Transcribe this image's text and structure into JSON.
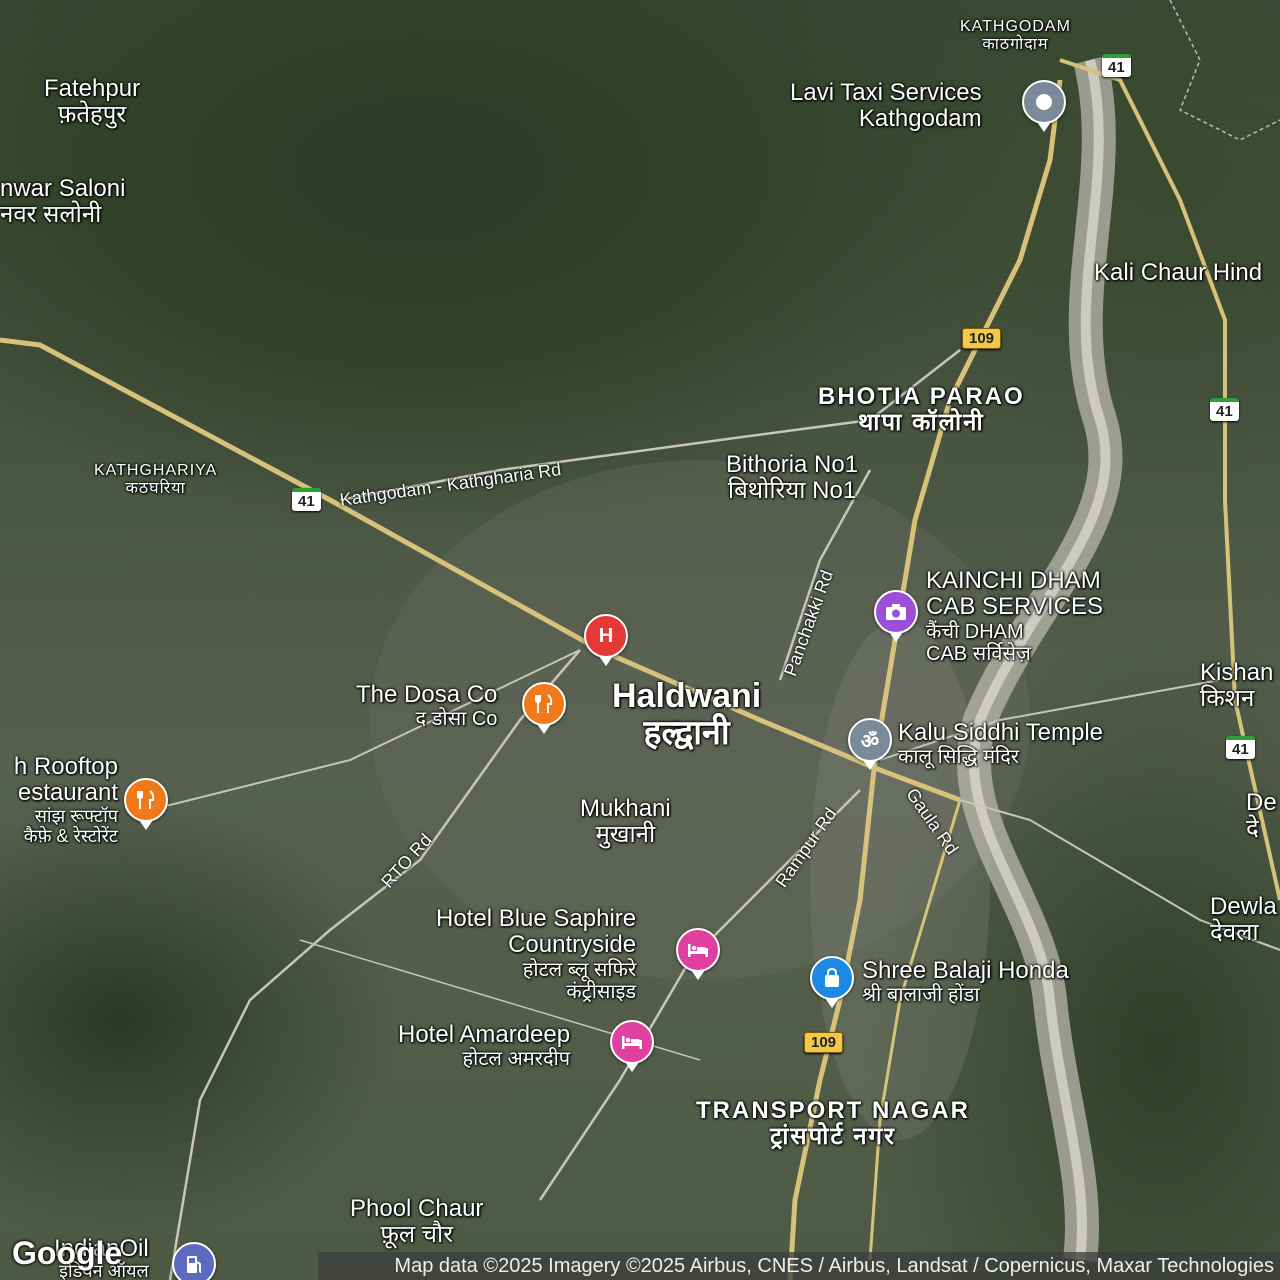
{
  "map": {
    "areas": {
      "kathgodam": {
        "en": "KATHGODAM",
        "hi": "काठगोदाम"
      },
      "bhotia_parao": {
        "en": "BHOTIA PARAO",
        "hi": "थापा कॉलोनी"
      },
      "kathghariya": {
        "en": "KATHGHARIYA",
        "hi": "कठघरिया"
      },
      "transport_nagar": {
        "en": "TRANSPORT NAGAR",
        "hi": "ट्रांसपोर्ट नगर"
      }
    },
    "places": {
      "fatehpur": {
        "en": "Fatehpur",
        "hi": "फ़तेहपुर"
      },
      "kanwar_saloni": {
        "en": "nwar Saloni",
        "hi": "नवर सलोनी"
      },
      "bithoria": {
        "en": "Bithoria No1",
        "hi": "बिथोरिया No1"
      },
      "haldwani": {
        "en": "Haldwani",
        "hi": "हल्द्वानी"
      },
      "mukhani": {
        "en": "Mukhani",
        "hi": "मुखानी"
      },
      "phool_chaur": {
        "en": "Phool Chaur",
        "hi": "फ़ूल चौर"
      },
      "kali_chaur": {
        "en": "Kali Chaur Hind"
      },
      "kishan": {
        "en": "Kishan",
        "hi": "किशन"
      },
      "de": {
        "en": "De",
        "hi": "दे"
      },
      "dewla": {
        "en": "Dewla",
        "hi": "देवला"
      }
    },
    "pois": {
      "lavi_taxi": {
        "name": "Lavi Taxi Services Kathgodam",
        "line1": "Lavi Taxi Services",
        "line2": "Kathgodam",
        "icon": "location-pin-icon",
        "color": "#7b8a99"
      },
      "kainchi_dham": {
        "line1": "KAINCHI DHAM",
        "line2": "CAB SERVICES",
        "hi1": "कैंची DHAM",
        "hi2": "CAB सर्विसेज़",
        "icon": "camera-icon",
        "color": "#9a4fd6"
      },
      "hospital": {
        "icon": "hospital-icon",
        "glyph": "H",
        "color": "#e53935"
      },
      "dosa_co": {
        "name": "The Dosa Co",
        "hi": "द डोसा Co",
        "icon": "restaurant-icon",
        "color": "#f07a1a"
      },
      "rooftop": {
        "line1": "h Rooftop",
        "line2": "estaurant",
        "hi1": "सांझ रूफ्टॉप",
        "hi2": "कैफ़े & रेस्टोरेंट",
        "icon": "restaurant-icon",
        "color": "#f07a1a"
      },
      "kalu_siddhi": {
        "name": "Kalu Siddhi Temple",
        "hi": "कालू सिद्धि मंदिर",
        "icon": "om-icon",
        "glyph": "ॐ",
        "color": "#7b8a99"
      },
      "blue_saphire": {
        "line1": "Hotel Blue Saphire",
        "line2": "Countryside",
        "hi1": "होटल ब्लू सफिरे",
        "hi2": "कंट्रीसाइड",
        "icon": "hotel-icon",
        "color": "#e040a0"
      },
      "amardeep": {
        "name": "Hotel Amardeep",
        "hi": "होटल अमरदीप",
        "icon": "hotel-icon",
        "color": "#e040a0"
      },
      "balaji_honda": {
        "name": "Shree Balaji Honda",
        "hi": "श्री बालाजी होंडा",
        "icon": "shopping-bag-icon",
        "color": "#1e88e5"
      },
      "indianoil": {
        "name": "IndianOil",
        "hi": "इंडियन ऑयल",
        "icon": "fuel-icon",
        "color": "#5c6bc0"
      }
    },
    "roads": {
      "kathgodam_kathgharia": "Kathgodam - Kathgharia Rd",
      "panchakki": "Panchakki Rd",
      "rto": "RTO Rd",
      "rampur": "Rampur Rd",
      "gaula": "Gaula Rd"
    },
    "shields": {
      "nh41": "41",
      "sh109": "109"
    },
    "attribution": "Map data ©2025 Imagery ©2025 Airbus, CNES / Airbus, Landsat / Copernicus, Maxar Technologies",
    "logo": "Google"
  }
}
